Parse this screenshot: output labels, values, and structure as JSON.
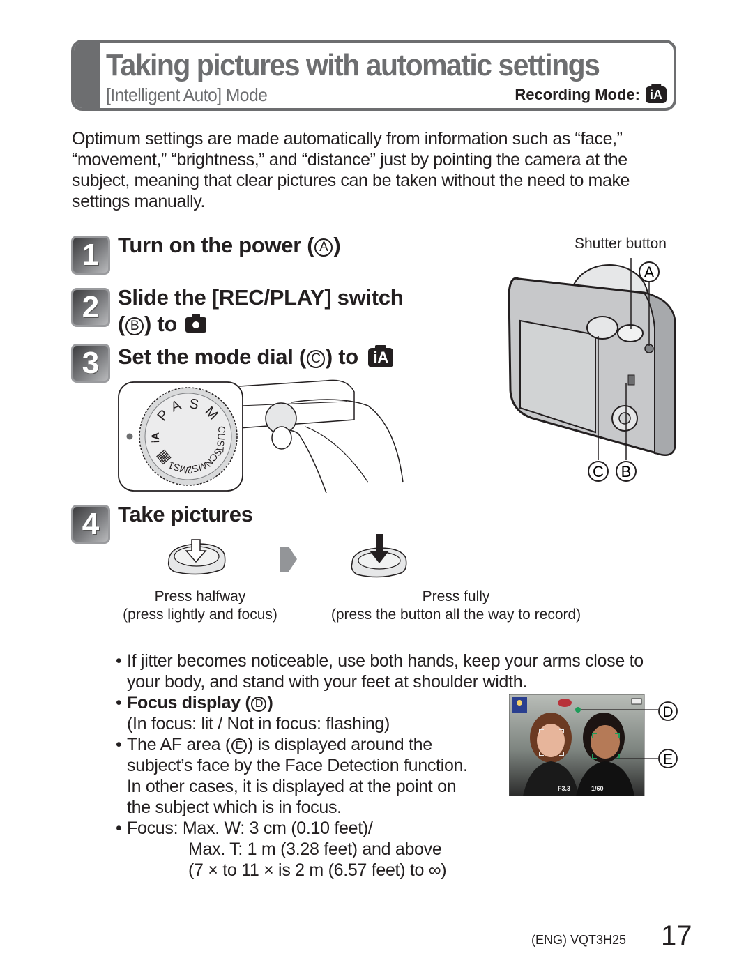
{
  "header": {
    "title": "Taking pictures with automatic settings",
    "subtitle": "[Intelligent Auto] Mode",
    "recording_mode_label": "Recording Mode:",
    "recording_mode_icon": "iA"
  },
  "intro": "Optimum settings are made automatically from information such as “face,” “movement,” “brightness,” and “distance” just by pointing the camera at the subject, meaning that clear pictures can be taken without the need to make settings manually.",
  "steps": [
    {
      "number": "1",
      "text_before": "Turn on the power (",
      "marker": "A",
      "text_after": ")"
    },
    {
      "number": "2",
      "line1": "Slide the [REC/PLAY] switch",
      "text_before": "(",
      "marker": "B",
      "text_after": ") to",
      "icon": "camera-icon"
    },
    {
      "number": "3",
      "text_before": "Set the mode dial (",
      "marker": "C",
      "text_after": ") to",
      "icon": "iA"
    },
    {
      "number": "4",
      "text": "Take pictures"
    }
  ],
  "camera_illustration": {
    "shutter_label": "Shutter button",
    "markers": [
      "A",
      "C",
      "B"
    ]
  },
  "mode_dial": {
    "positions": [
      "P",
      "A",
      "S",
      "M",
      "CUST",
      "SCN",
      "MS2",
      "MS1",
      "movie",
      "iA"
    ],
    "selected": "iA"
  },
  "press": {
    "halfway_title": "Press halfway",
    "halfway_desc": "(press lightly and focus)",
    "fully_title": "Press fully",
    "fully_desc": "(press the button all the way to record)"
  },
  "notes": {
    "jitter": "If jitter becomes noticeable, use both hands, keep your arms close to your body, and stand with your feet at shoulder width.",
    "focus_display_before": "Focus display (",
    "focus_display_marker": "D",
    "focus_display_after": ")",
    "focus_display_desc": "(In focus: lit / Not in focus: flashing)",
    "af_before": "The AF area (",
    "af_marker": "E",
    "af_after": ") is displayed around the subject’s face by the Face Detection function. In other cases, it is displayed at the point on the subject which is in focus.",
    "focus_line1": "Focus: Max. W: 3 cm (0.10 feet)/",
    "focus_line2": "Max. T: 1 m (3.28 feet) and above",
    "focus_line3": "(7 × to 11 × is 2 m (6.57 feet) to ∞)"
  },
  "screen_photo": {
    "markers": [
      "D",
      "E"
    ],
    "readout_aperture": "F3.3",
    "readout_shutter": "1/60",
    "focus_color": "#1e9c5a"
  },
  "footer": {
    "code": "(ENG) VQT3H25",
    "page": "17"
  },
  "colors": {
    "header_gray": "#6d6e70",
    "text": "#231f20"
  }
}
